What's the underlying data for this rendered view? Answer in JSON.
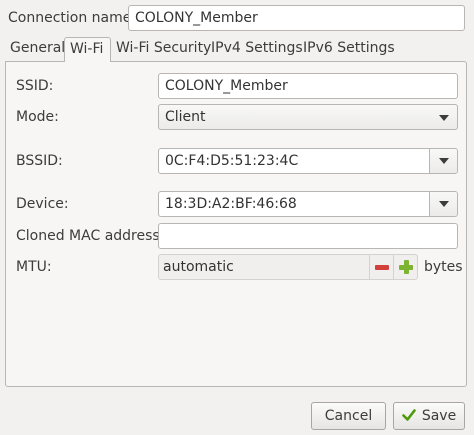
{
  "connection": {
    "label": "Connection name:",
    "value": "COLONY_Member"
  },
  "tabs": [
    {
      "label": "General"
    },
    {
      "label": "Wi-Fi",
      "active": true
    },
    {
      "label": "Wi-Fi Security"
    },
    {
      "label": "IPv4 Settings"
    },
    {
      "label": "IPv6 Settings"
    }
  ],
  "wifi": {
    "ssid": {
      "label": "SSID:",
      "value": "COLONY_Member"
    },
    "mode": {
      "label": "Mode:",
      "value": "Client"
    },
    "bssid": {
      "label": "BSSID:",
      "value": "0C:F4:D5:51:23:4C"
    },
    "device": {
      "label": "Device:",
      "value": "18:3D:A2:BF:46:68"
    },
    "cloned_mac": {
      "label": "Cloned MAC address:",
      "value": ""
    },
    "mtu": {
      "label": "MTU:",
      "value": "automatic",
      "unit": "bytes"
    }
  },
  "buttons": {
    "cancel": "Cancel",
    "save": "Save"
  },
  "colors": {
    "minus": "#d1403a",
    "plus": "#7cb330",
    "save_check": "#4e9a06"
  },
  "icons": [
    "chevron-down-icon",
    "minus-icon",
    "plus-icon",
    "checkmark-icon"
  ]
}
